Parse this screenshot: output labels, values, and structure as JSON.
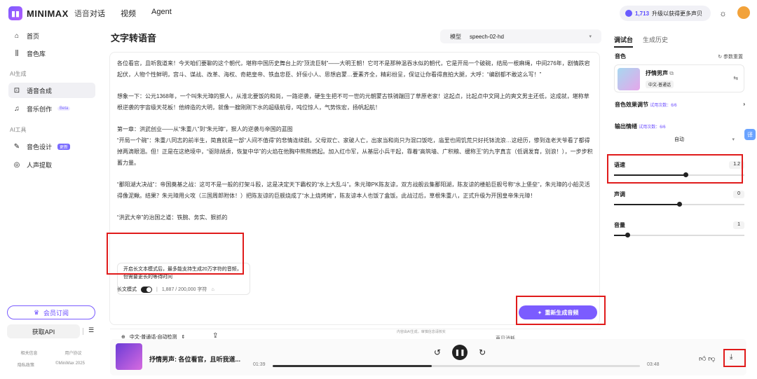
{
  "brand": {
    "name": "MINIMAX",
    "sub": "语音"
  },
  "topnav": [
    "对话",
    "视频",
    "Agent"
  ],
  "credits": {
    "count": "1,713",
    "text": "升级以获得更多声贝"
  },
  "sidebar": {
    "items": [
      {
        "label": "首页",
        "icon": "home-icon"
      },
      {
        "label": "音色库",
        "icon": "library-icon"
      }
    ],
    "section_ai_gen": "AI生成",
    "gen_items": [
      {
        "label": "语音合成",
        "icon": "speech-icon"
      },
      {
        "label": "音乐创作",
        "icon": "music-icon",
        "badge": "Beta"
      }
    ],
    "section_ai_tools": "AI工具",
    "tool_items": [
      {
        "label": "音色设计",
        "icon": "voice-design-icon",
        "badge": "更新"
      },
      {
        "label": "人声提取",
        "icon": "vocal-extract-icon"
      }
    ],
    "vip_label": "会员订阅",
    "api_label": "获取API",
    "footer": {
      "row1": [
        "相关信息",
        "用户协议"
      ],
      "row2": [
        "隐私政策",
        "©MiniMax 2025"
      ]
    }
  },
  "main": {
    "title": "文字转语音",
    "model_label": "模型",
    "model_value": "speech-02-hd",
    "paragraphs": [
      "各位看官，且听我道来！今天咱们要聊的这个朝代，堪称中国历史舞台上的“顶流巨制”——大明王朝！它可不是那种温吞水似的朝代，它是开局一个破碗，结局一根麻绳，中间276年，剧情跌宕起伏，人物个性鲜明，宫斗、谋战、改革、海权、奇葩皇帝、铁血忠臣、奸佞小人、思想启蒙…要素齐全，精彩纷呈，保证让你看得直拍大腿，大呼：“编剧都不敢这么写！”",
      "想象一下：公元1368年，一个叫朱元璋的狠人，从淮北要饭的和尚，一路逆袭，硬生生把不可一世的元朝蒙古铁骑踹回了草原老家！这起点，比起点中文网上的爽文男主还低，这成就，堪称草根逆袭的宇宙级天花板！他缔造的大明，就像一艘刚刚下水的超级航母，吨位惊人，气势恢宏，扬帆起航！",
      "第一章：洪武创业——从“朱重八”到“朱元璋”，狠人的逆袭与帝国的蓝图\n“开局一个碗”：朱重八同志的前半生，简直就是一部“人间不值得”的悲情连续剧。父母双亡、家破人亡，出家当和尚只为混口饭吃，庙里也闹饥荒只好托钵流浪…这经历，惨到连老天爷看了都得掉两滴眼泪。但！正是在这绝境中，“驱除胡虏，恢复中华”的火焰在他胸中熊熊燃起。加入红巾军，从基层小兵干起，靠着“高筑墙、广积粮、缓称王”的九字真言（低调发育，别浪！），一步步积蓄力量。",
      "“鄱阳湖大决战”：帝国奠基之战：这可不是一般的打架斗殴，这是决定天下霸权的“水上大乱斗”。朱元璋PK陈友谅，双方战舰云集鄱阳湖，陈友谅的楼船巨舰号称“水上堡垒”，朱元璋的小船灵活得像泥鳅。结果？朱元璋用火攻（三国周郎附体！）把陈友谅的巨舰烧成了“水上烧烤摊”，陈友谅本人也饭了盒饭。此战过后，草根朱重八，正式升级为开国皇帝朱元璋！",
      "“洪武大帝”的治国之道：铁腕、务实、狠抓的"
    ],
    "long_tip": "开启长文本模式后，最多能支持生成20万字符的音频，但需要更长的等待时间",
    "long_mode_label": "长文模式",
    "char_count": "1,887 / 200,000 字符",
    "lang_select": "中文-普通话-自动检测",
    "credit_consume": "声贝消耗",
    "regen_label": "重新生成音频",
    "ai_note": "内容由AI生成，审慎信息请核实"
  },
  "player": {
    "title": "抒情男声: 各位看官，且听我道...",
    "time_elapsed": "01:39",
    "time_total": "03:48",
    "progress": 0.434
  },
  "rpanel": {
    "tabs": [
      "调试台",
      "生成历史"
    ],
    "voice_label": "音色",
    "reset_label": "参数重置",
    "voice_name": "抒情男声",
    "voice_tag": "中文-普通话",
    "effect_label": "音色效果调节",
    "trial_effect": "试用次数：6/6",
    "emotion_label": "输出情绪",
    "trial_emotion": "试用次数：6/6",
    "emotion_value": "自动",
    "sliders": [
      {
        "label": "语速",
        "value": "1.2",
        "ratio": 0.55
      },
      {
        "label": "声调",
        "value": "0",
        "ratio": 0.5
      },
      {
        "label": "音量",
        "value": "1",
        "ratio": 0.1
      }
    ]
  },
  "colors": {
    "accent": "#7b5cff",
    "highlight": "#e01b1b"
  }
}
